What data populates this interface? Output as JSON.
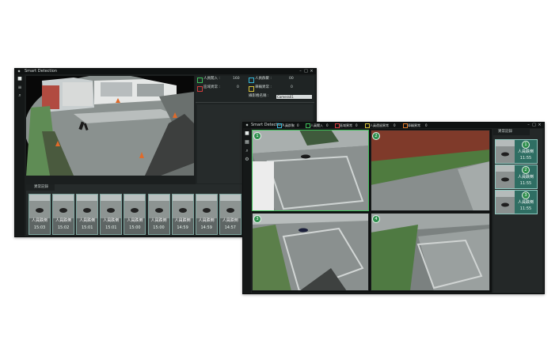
{
  "left_window": {
    "title": "Smart Detection",
    "stats": [
      {
        "label": "人員闖入 :",
        "value": "160",
        "color": "#3fbf5a"
      },
      {
        "label": "人員群聚 :",
        "value": "00",
        "color": "#35b7d8"
      },
      {
        "label": "區域異常 :",
        "value": "0",
        "color": "#d23c3c"
      },
      {
        "label": "車輛異常 :",
        "value": "0",
        "color": "#d7c23a"
      }
    ],
    "camera_label": "攝影機名稱 :",
    "camera_value": "Camera01",
    "events_title": "異常記錄",
    "events": [
      {
        "label": "人員跌倒",
        "time": "15:03"
      },
      {
        "label": "人員跌倒",
        "time": "15:02"
      },
      {
        "label": "人員跌倒",
        "time": "15:01"
      },
      {
        "label": "人員跌倒",
        "time": "15:01"
      },
      {
        "label": "人員跌倒",
        "time": "15:00"
      },
      {
        "label": "人員跌倒",
        "time": "15:00"
      },
      {
        "label": "人員跌倒",
        "time": "14:59"
      },
      {
        "label": "人員跌倒",
        "time": "14:59"
      },
      {
        "label": "人員跌倒",
        "time": "14:57"
      }
    ]
  },
  "right_window": {
    "title": "Smart Detection",
    "tabs": [
      {
        "label": "人員群聚",
        "count": "0",
        "color": "#35b7d8"
      },
      {
        "label": "人員闖入",
        "count": "0",
        "color": "#3fbf5a"
      },
      {
        "label": "區域異常",
        "count": "0",
        "color": "#d23c3c"
      },
      {
        "label": "人員遺留異常",
        "count": "0",
        "color": "#d7c23a"
      },
      {
        "label": "車輛異常",
        "count": "0",
        "color": "#e07a2a"
      }
    ],
    "cameras": [
      "1",
      "2",
      "3",
      "4"
    ],
    "events_title": "異常記錄",
    "events": [
      {
        "badge": "1",
        "label": "人員跌倒",
        "time": "11:55"
      },
      {
        "badge": "2",
        "label": "人員跌倒",
        "time": "11:55"
      },
      {
        "badge": "3",
        "label": "人員跌倒",
        "time": "11:55"
      }
    ]
  }
}
